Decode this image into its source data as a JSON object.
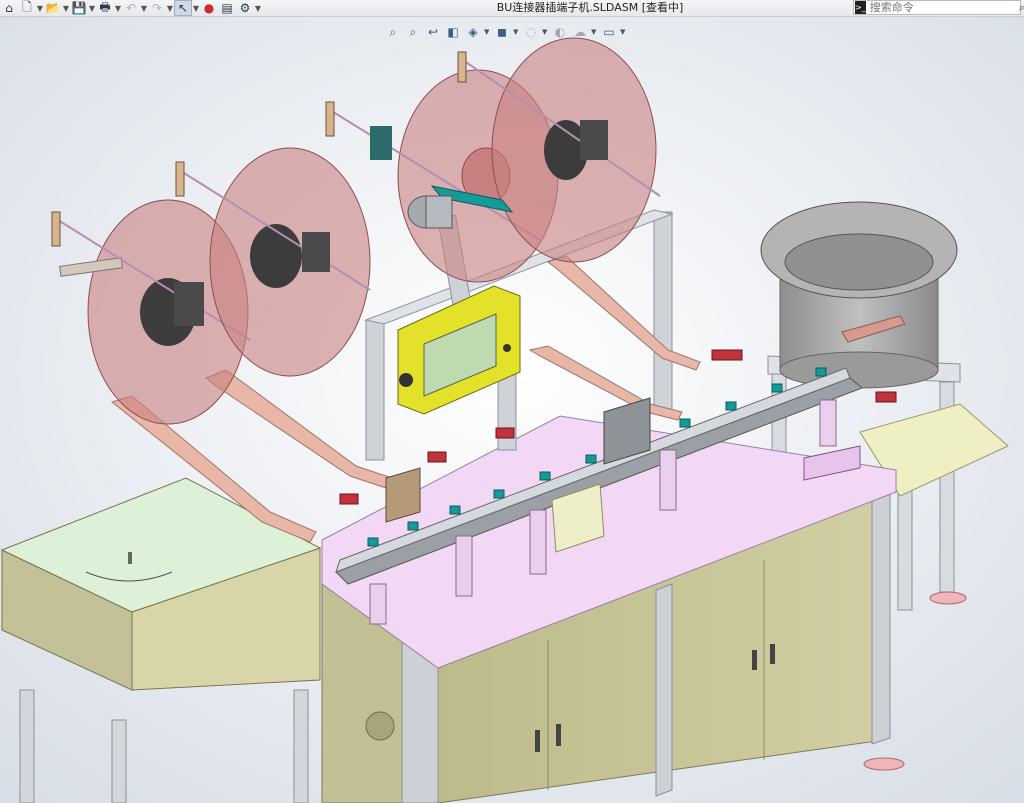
{
  "window": {
    "title": "BU连接器插端子机.SLDASM [查看中]"
  },
  "toolbar": {
    "buttons": [
      {
        "name": "home-icon",
        "glyph": "⌂"
      },
      {
        "name": "new-document-icon",
        "glyph": "🗋"
      },
      {
        "name": "open-icon",
        "glyph": "📂"
      },
      {
        "name": "save-icon",
        "glyph": "💾"
      },
      {
        "name": "print-icon",
        "glyph": "🖶"
      },
      {
        "name": "undo-icon",
        "glyph": "↶"
      },
      {
        "name": "redo-icon",
        "glyph": "↷"
      },
      {
        "name": "select-pointer-icon",
        "glyph": "↖"
      },
      {
        "name": "rebuild-traffic-light-icon",
        "glyph": "●"
      },
      {
        "name": "file-properties-icon",
        "glyph": "▤"
      },
      {
        "name": "options-gear-icon",
        "glyph": "⚙"
      }
    ]
  },
  "search": {
    "placeholder": "搜索命令"
  },
  "headsup_toolbar": [
    {
      "name": "zoom-to-fit-icon",
      "glyph": "⌕"
    },
    {
      "name": "zoom-to-area-icon",
      "glyph": "⌕"
    },
    {
      "name": "previous-view-icon",
      "glyph": "↩"
    },
    {
      "name": "section-view-icon",
      "glyph": "◧"
    },
    {
      "name": "view-orientation-icon",
      "glyph": "◈"
    },
    {
      "name": "display-style-icon",
      "glyph": "◼"
    },
    {
      "name": "hide-show-items-icon",
      "glyph": "◌"
    },
    {
      "name": "edit-appearance-icon",
      "glyph": "◐"
    },
    {
      "name": "apply-scene-icon",
      "glyph": "☁"
    },
    {
      "name": "view-settings-icon",
      "glyph": "▭"
    }
  ],
  "colors": {
    "table_top": "#f1d6f3",
    "cabinet": "#c9c79a",
    "frame": "#c5c9ce",
    "reel": "#c98080",
    "accent": "#159a9a",
    "bowl": "#a4a4a4",
    "screen": "#e3e12a"
  }
}
